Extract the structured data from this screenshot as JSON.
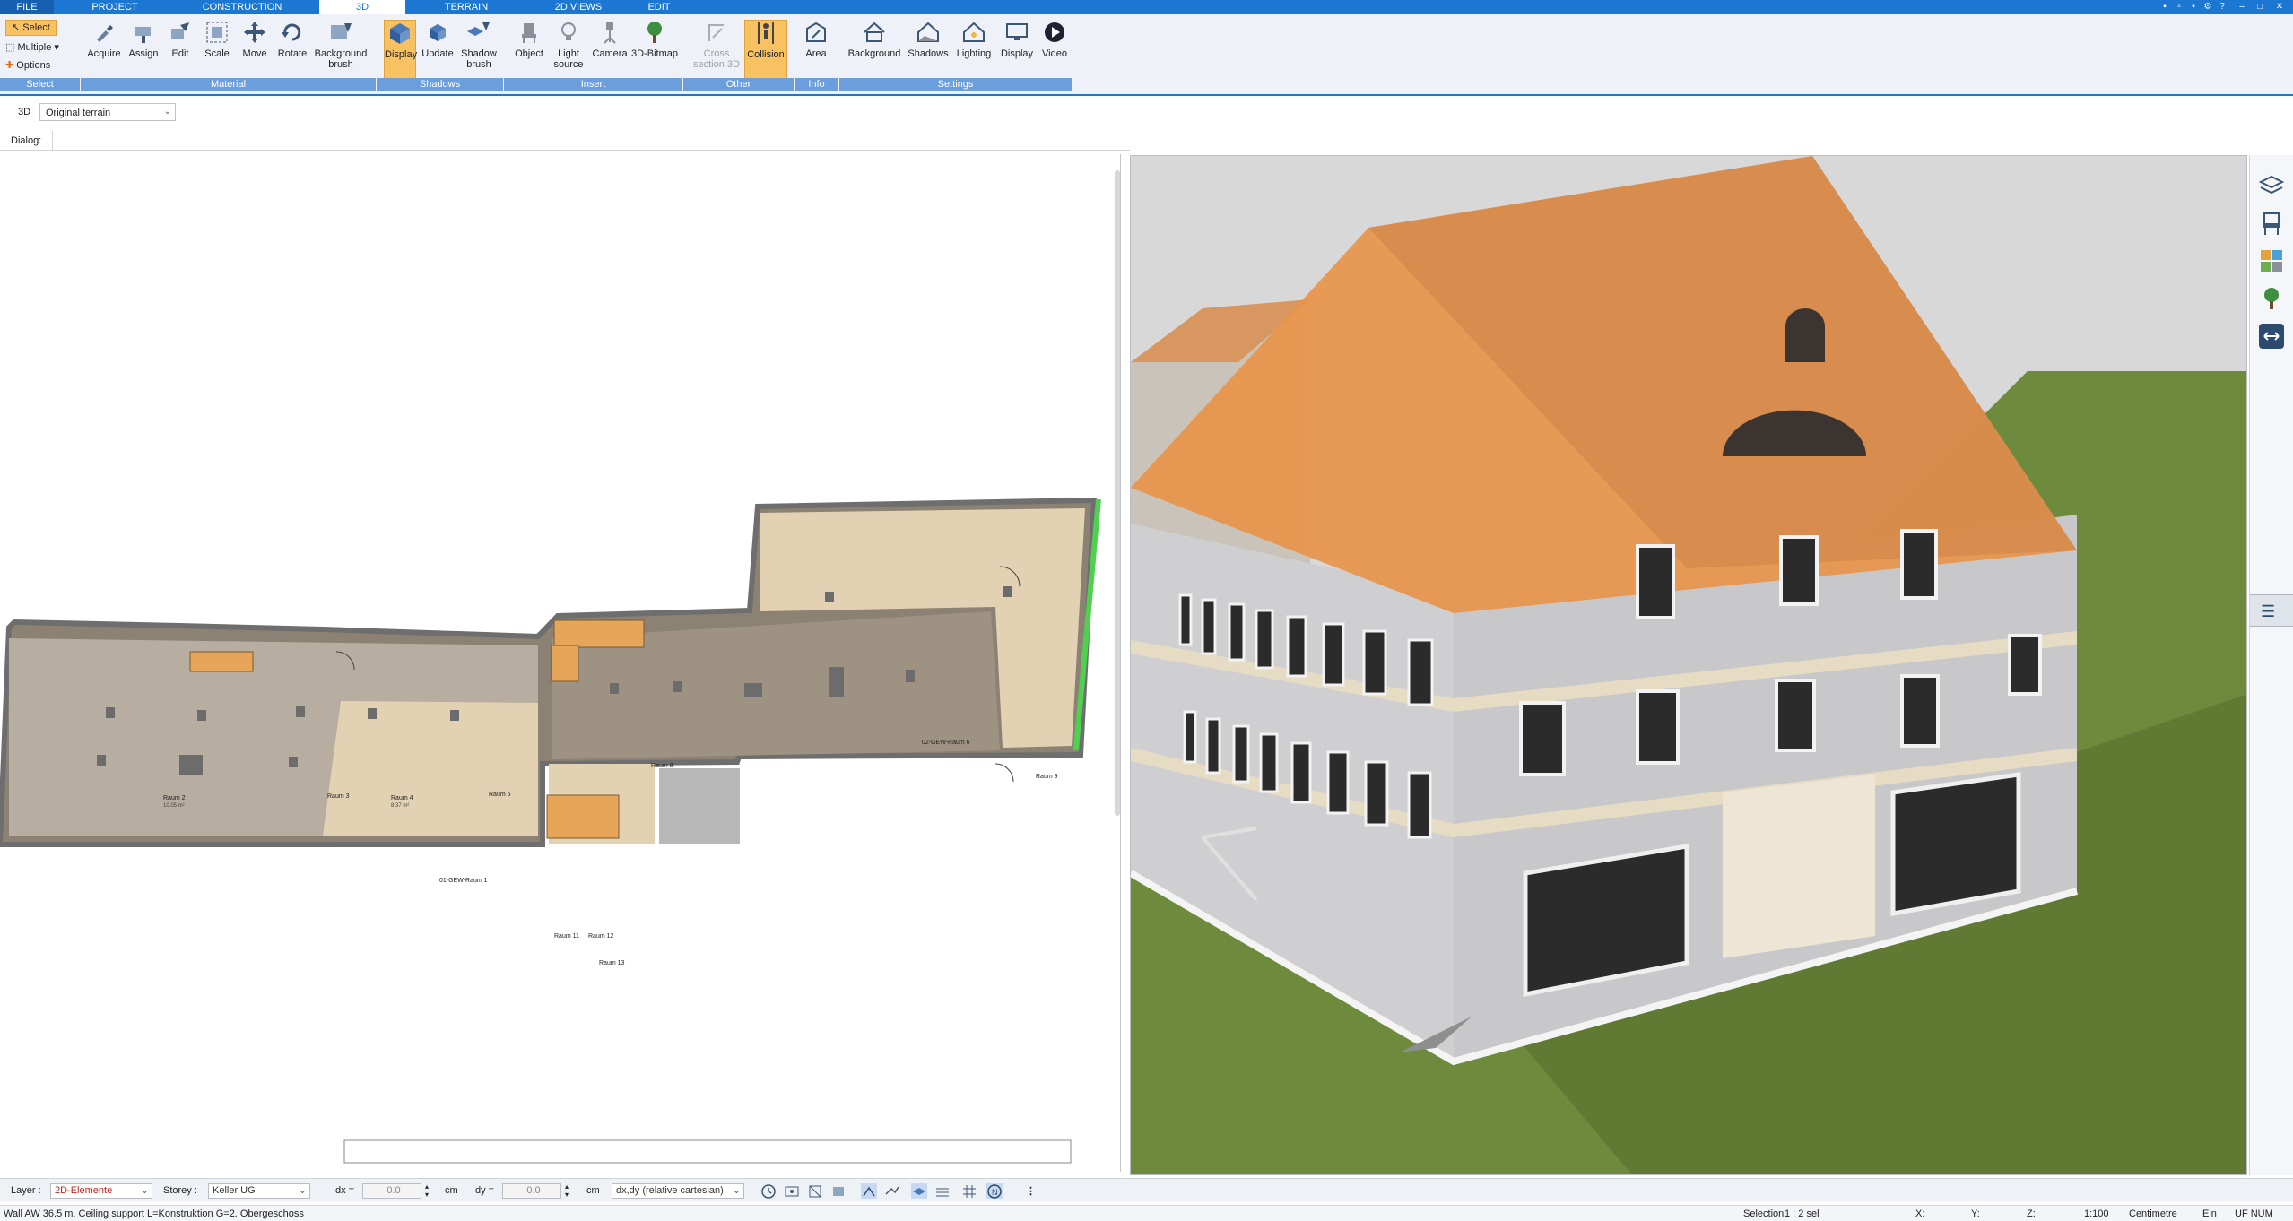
{
  "tabs": [
    "FILE",
    "PROJECT",
    "CONSTRUCTION",
    "3D",
    "TERRAIN",
    "2D VIEWS",
    "EDIT"
  ],
  "ribbon": {
    "select": {
      "select_label": "Select",
      "multiple_label": "Multiple",
      "options_label": "Options",
      "group": "Select"
    },
    "material": {
      "buttons": [
        "Acquire",
        "Assign",
        "Edit",
        "Scale",
        "Move",
        "Rotate",
        "Background brush"
      ],
      "group": "Material"
    },
    "shadows": {
      "buttons": [
        "Display",
        "Update",
        "Shadow brush"
      ],
      "group": "Shadows"
    },
    "insert": {
      "buttons": [
        "Object",
        "Light source",
        "Camera",
        "3D-Bitmap"
      ],
      "group": "Insert"
    },
    "other": {
      "buttons": [
        "Cross section 3D",
        "Collision"
      ],
      "group": "Other"
    },
    "info": {
      "buttons": [
        "Area"
      ],
      "group": "Info"
    },
    "settings": {
      "buttons": [
        "Background",
        "Shadows",
        "Lighting",
        "Display",
        "Video"
      ],
      "group": "Settings"
    }
  },
  "view_selector": {
    "label": "3D",
    "value": "Original terrain"
  },
  "dialog_label": "Dialog:",
  "plan": {
    "rooms": [
      {
        "name": "Raum 2",
        "area": "10.05 m²"
      },
      {
        "name": "Raum 3",
        "area": ""
      },
      {
        "name": "Raum 4",
        "area": "8.37 m²"
      },
      {
        "name": "Raum 5",
        "area": ""
      },
      {
        "name": "01-GEW-Raum 1",
        "area": ""
      },
      {
        "name": "02-GEW-Raum 6",
        "area": ""
      },
      {
        "name": "Raum 8",
        "area": ""
      },
      {
        "name": "Raum 9",
        "area": ""
      },
      {
        "name": "Raum 11",
        "area": ""
      },
      {
        "name": "Raum 12",
        "area": ""
      },
      {
        "name": "Raum 13",
        "area": ""
      }
    ]
  },
  "sidedock": {
    "icons": [
      "layers-icon",
      "chair-icon",
      "materials-icon",
      "tree-icon",
      "swap-icon"
    ]
  },
  "bottombar": {
    "layer_label": "Layer :",
    "layer_value": "2D-Elemente",
    "storey_label": "Storey :",
    "storey_value": "Keller UG",
    "dx_label": "dx =",
    "dx_value": "0.0",
    "dx_unit": "cm",
    "dy_label": "dy =",
    "dy_value": "0.0",
    "dy_unit": "cm",
    "coord_mode": "dx,dy (relative cartesian)"
  },
  "statusbar": {
    "message": "Wall AW 36.5 m. Ceiling support L=Konstruktion G=2. Obergeschoss",
    "selection_label": "Selection",
    "selection_value": "1 : 2 sel",
    "x_label": "X:",
    "y_label": "Y:",
    "z_label": "Z:",
    "scale": "1:100",
    "unit": "Centimetre",
    "mode": "Ein",
    "flags": "UF NUM"
  },
  "colors": {
    "accent": "#1c77d2",
    "highlight": "#f8c262",
    "roof": "#e8954a",
    "grass": "#6e8b3d",
    "wall": "#c9c9cb"
  }
}
